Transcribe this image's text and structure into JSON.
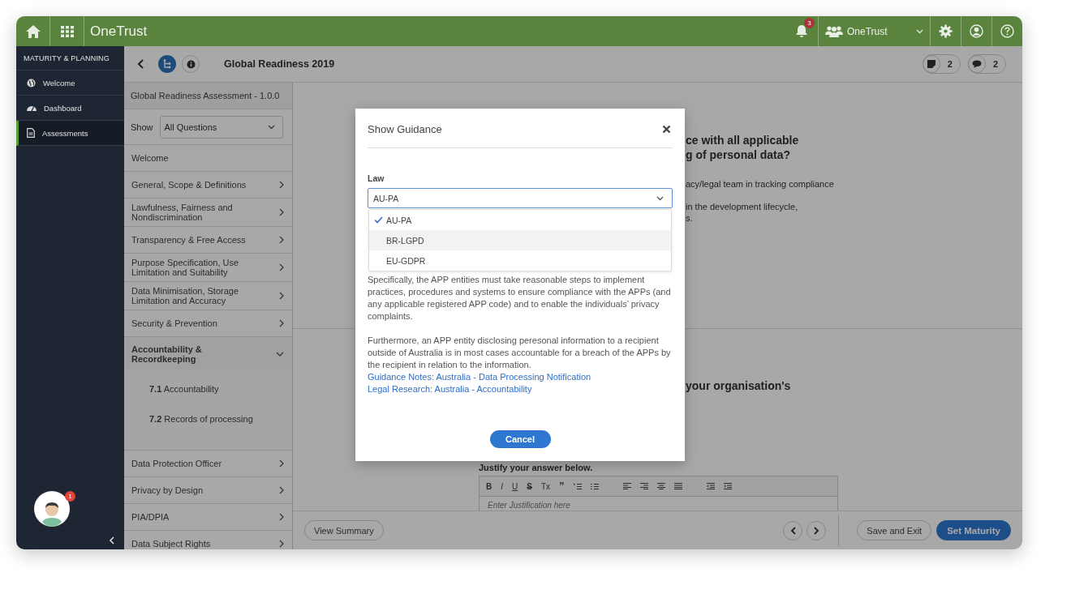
{
  "topbar": {
    "logo": "OneTrust",
    "notification_count": "3",
    "org_switcher": "OneTrust"
  },
  "sidebar": {
    "heading": "MATURITY & PLANNING",
    "items": [
      {
        "label": "Welcome",
        "kind": "globe",
        "selected": false
      },
      {
        "label": "Dashboard",
        "kind": "gauge",
        "selected": false
      },
      {
        "label": "Assessments",
        "kind": "document",
        "selected": true
      }
    ],
    "assistant_badge": "1"
  },
  "header": {
    "title": "Global Readiness 2019",
    "notes_count": "2",
    "comments_count": "2"
  },
  "outline": {
    "title": "Global Readiness Assessment - 1.0.0",
    "filter_label": "Show",
    "filter_value": "All Questions",
    "sections": [
      {
        "label": "Welcome",
        "kind": "plain",
        "expanded": false
      },
      {
        "label": "General, Scope & Definitions",
        "kind": "group",
        "expanded": false
      },
      {
        "label": "Lawfulness, Fairness and Nondiscrimination",
        "kind": "group",
        "expanded": false
      },
      {
        "label": "Transparency & Free Access",
        "kind": "group",
        "expanded": false
      },
      {
        "label": "Purpose Specification, Use Limitation and Suitability",
        "kind": "group",
        "expanded": false
      },
      {
        "label": "Data Minimisation, Storage Limitation and Accuracy",
        "kind": "group",
        "expanded": false
      },
      {
        "label": "Security & Prevention",
        "kind": "group",
        "expanded": false
      },
      {
        "label": "Accountability & Recordkeeping",
        "kind": "group",
        "expanded": true,
        "children": [
          {
            "number": "7.1",
            "label": "Accountability"
          },
          {
            "number": "7.2",
            "label": "Records of processing"
          }
        ]
      },
      {
        "label": "Data Protection Officer",
        "kind": "group",
        "expanded": false
      },
      {
        "label": "Privacy by Design",
        "kind": "group",
        "expanded": false
      },
      {
        "label": "PIA/DPIA",
        "kind": "group",
        "expanded": false
      },
      {
        "label": "Data Subject Rights",
        "kind": "group",
        "expanded": false
      }
    ]
  },
  "question_1": {
    "heading_lines": [
      "ce with all applicable",
      "g of personal data?"
    ],
    "text_lines": [
      "acy/legal team in tracking compliance",
      "in the development lifecycle,",
      "s."
    ]
  },
  "question_2": {
    "heading_lines": [
      "your organisation's"
    ],
    "justify_label": "Justify your answer below.",
    "editor_tools": [
      "B",
      "I",
      "U",
      "S",
      "Tx",
      "”"
    ],
    "placeholder": "Enter Justification here"
  },
  "footer": {
    "view_summary": "View Summary",
    "save_exit": "Save and Exit",
    "set_maturity": "Set Maturity"
  },
  "modal": {
    "title": "Show Guidance",
    "law_label": "Law",
    "law_value": "AU-PA",
    "options": [
      {
        "label": "AU-PA",
        "selected": true,
        "highlighted": false
      },
      {
        "label": "BR-LGPD",
        "selected": false,
        "highlighted": true
      },
      {
        "label": "EU-GDPR",
        "selected": false,
        "highlighted": false
      }
    ],
    "paragraphs": [
      "Specifically, the APP entities must take reasonable steps to implement practices, procedures and systems to ensure compliance with the APPs (and any applicable registered APP code) and to enable the individuals’ privacy complaints.",
      "Furthermore, an APP entity disclosing peresonal information to a recipient outside of Australia is in most cases accountable for a breach of the APPs by the recipient in relation to the information."
    ],
    "links": [
      "Guidance Notes: Australia - Data Processing Notification",
      "Legal Research: Australia - Accountability"
    ],
    "cancel": "Cancel"
  }
}
